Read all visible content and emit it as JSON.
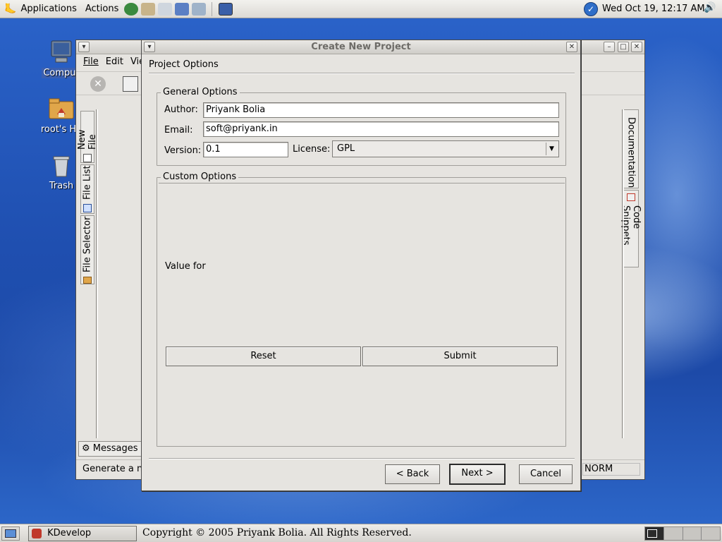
{
  "top_panel": {
    "applications": "Applications",
    "actions": "Actions",
    "clock": "Wed Oct 19, 12:17 AM"
  },
  "desktop": {
    "icons": [
      {
        "label": "Comput"
      },
      {
        "label": "root's Ho"
      },
      {
        "label": "Trash"
      }
    ]
  },
  "kdevelop_window": {
    "menu": [
      "File",
      "Edit",
      "Vie"
    ],
    "left_tabs": [
      "New File",
      "File List",
      "File Selector"
    ],
    "right_tabs": [
      "Documentation",
      "Code Snippets"
    ],
    "messages_tab": "Messages",
    "status_left": "Generate a ne",
    "status_right": "NORM"
  },
  "dialog": {
    "title": "Create New Project",
    "heading": "Project Options",
    "general_group": "General Options",
    "author_label": "Author:",
    "author_value": "Priyank Bolia",
    "email_label": "Email:",
    "email_value": "soft@priyank.in",
    "version_label": "Version:",
    "version_value": "0.1",
    "license_label": "License:",
    "license_value": "GPL",
    "custom_group": "Custom Options",
    "value_for_label": "Value for",
    "reset_label": "Reset",
    "submit_label": "Submit",
    "back_label": "< Back",
    "next_label": "Next >",
    "cancel_label": "Cancel"
  },
  "taskbar": {
    "task_label": "KDevelop",
    "copyright": "Copyright © 2005 Priyank Bolia. All Rights Reserved."
  }
}
